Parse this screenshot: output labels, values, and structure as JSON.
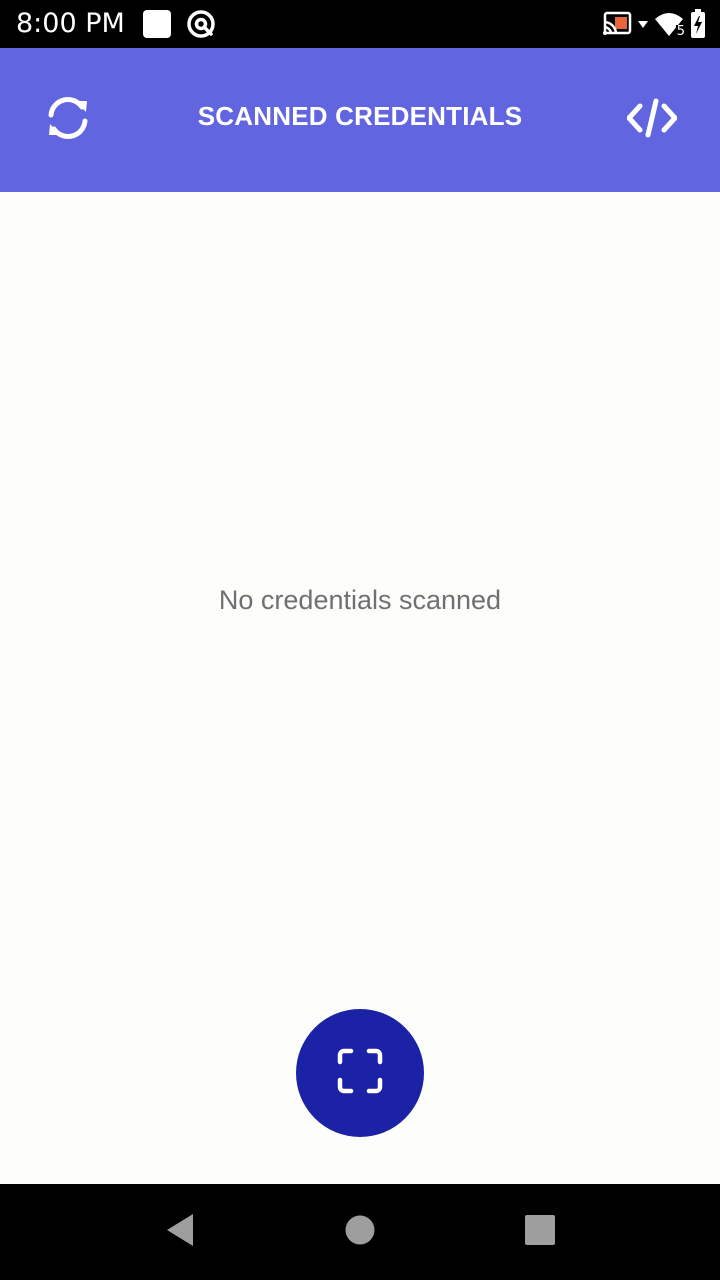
{
  "status_bar": {
    "time": "8:00 PM",
    "icons": [
      "notification-square-icon",
      "at-sign-icon",
      "cast-icon",
      "wifi-icon",
      "battery-charging-icon"
    ],
    "wifi_badge": "5"
  },
  "app_bar": {
    "title": "SCANNED CREDENTIALS",
    "left_icon": "refresh-icon",
    "right_icon": "code-icon",
    "background_color": "#6166e0"
  },
  "main": {
    "empty_message": "No credentials scanned"
  },
  "fab": {
    "icon": "scan-frame-icon",
    "background_color": "#1c22a6"
  },
  "nav_bar": {
    "icons": [
      "back-icon",
      "home-icon",
      "recents-icon"
    ]
  }
}
